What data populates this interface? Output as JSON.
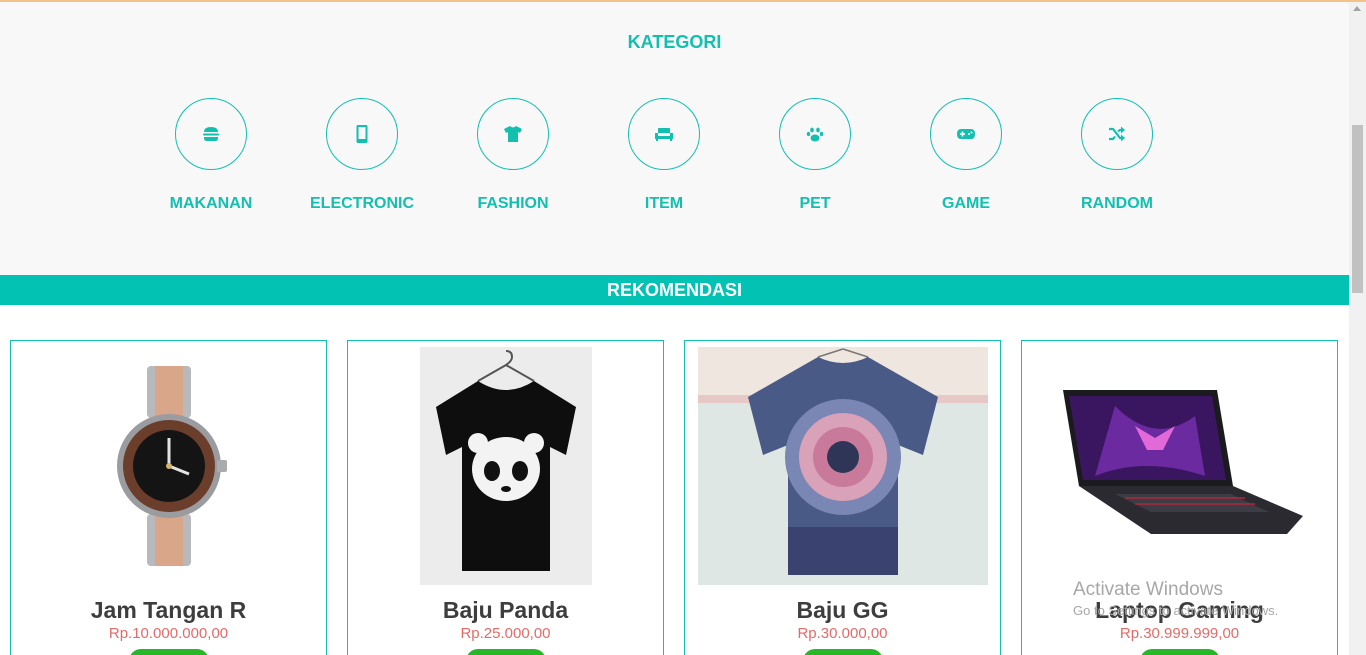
{
  "kategori": {
    "title": "KATEGORI",
    "items": [
      {
        "label": "MAKANAN",
        "icon": "hamburger-icon"
      },
      {
        "label": "ELECTRONIC",
        "icon": "mobile-icon"
      },
      {
        "label": "FASHION",
        "icon": "tshirt-icon"
      },
      {
        "label": "ITEM",
        "icon": "couch-icon"
      },
      {
        "label": "PET",
        "icon": "paw-icon"
      },
      {
        "label": "GAME",
        "icon": "gamepad-icon"
      },
      {
        "label": "RANDOM",
        "icon": "shuffle-icon"
      }
    ]
  },
  "rekomendasi": {
    "title": "REKOMENDASI",
    "products": [
      {
        "name": "Jam Tangan R",
        "price": "Rp.10.000.000,00",
        "image": "watch-image"
      },
      {
        "name": "Baju Panda",
        "price": "Rp.25.000,00",
        "image": "panda-shirt-image"
      },
      {
        "name": "Baju GG",
        "price": "Rp.30.000,00",
        "image": "tie-dye-shirt-image"
      },
      {
        "name": "Laptop Gaming",
        "price": "Rp.30.999.999,00",
        "image": "laptop-image"
      }
    ]
  },
  "watermark": {
    "title": "Activate Windows",
    "subtitle": "Go to Settings to activate Windows."
  },
  "colors": {
    "accent": "#13c0b0",
    "bar": "#02c2b3",
    "price": "#e46a6a",
    "buy_button": "#27b827"
  }
}
